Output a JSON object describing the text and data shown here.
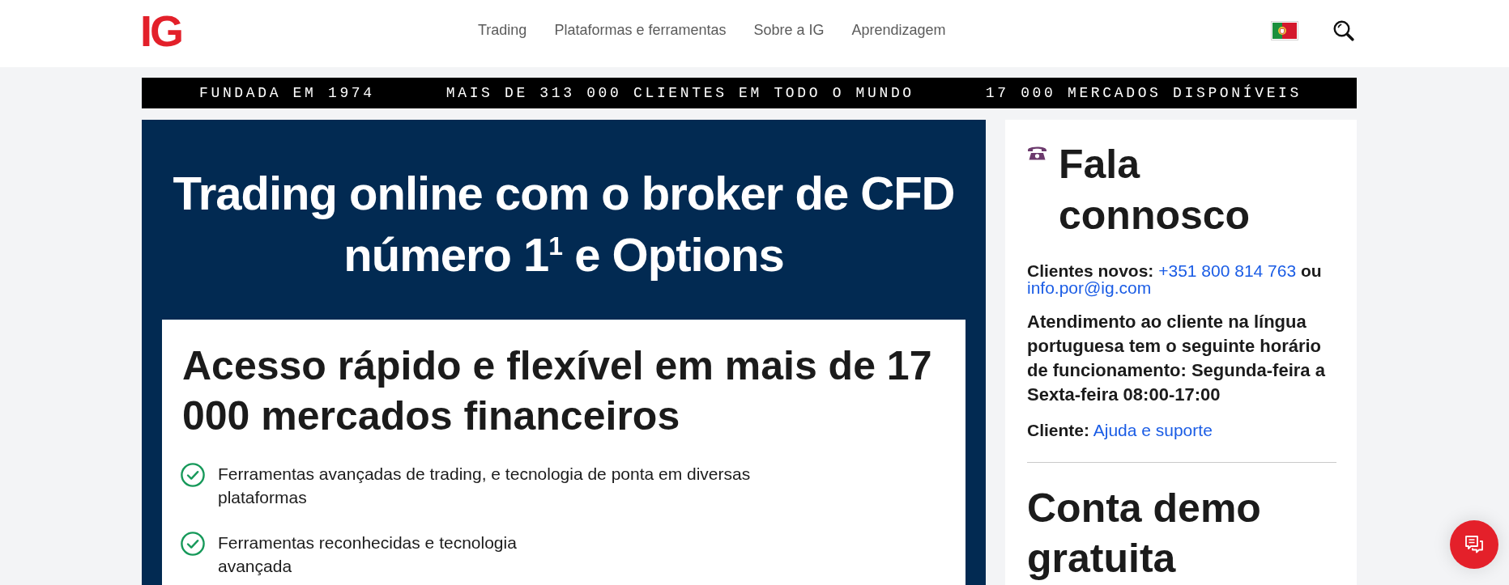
{
  "header": {
    "logo": "IG",
    "nav": [
      "Trading",
      "Plataformas e ferramentas",
      "Sobre a IG",
      "Aprendizagem"
    ]
  },
  "banner": {
    "items": [
      "FUNDADA EM 1974",
      "MAIS DE 313 000 CLIENTES EM TODO O MUNDO",
      "17 000 MERCADOS DISPONÍVEIS"
    ]
  },
  "hero": {
    "title": "Trading online com o broker de CFD número 1$^{1}$ e Options",
    "card": {
      "title": "Acesso rápido e flexível em mais de 17 000 mercados financeiros",
      "features": [
        {
          "lines": [
            "Ferramentas avançadas de trading, e tecnologia de ponta em diversas",
            "plataformas"
          ]
        },
        {
          "lines": [
            "Ferramentas reconhecidas e tecnologia",
            "avançada"
          ]
        }
      ]
    }
  },
  "sidebar": {
    "contact": {
      "title": "Fala connosco",
      "new_clients": {
        "label": "Clientes novos:",
        "phone": "+351 800 814 763",
        "joiner": "ou",
        "email": "info.por@ig.com"
      },
      "hours": "Atendimento ao cliente na língua portuguesa tem o seguinte horário de funcionamento: Segunda-feira a Sexta-feira 08:00-17:00",
      "support": {
        "label": "Cliente:",
        "link": "Ajuda e suporte"
      }
    },
    "demo": {
      "title": "Conta demo gratuita"
    }
  }
}
